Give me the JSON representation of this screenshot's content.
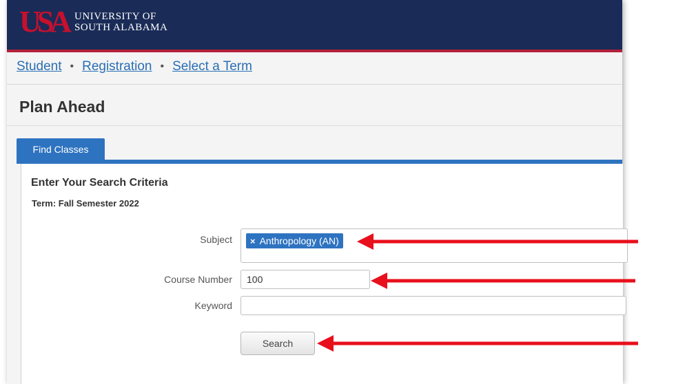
{
  "header": {
    "logo_mark": "USA",
    "logo_line1": "UNIVERSITY OF",
    "logo_line2": "SOUTH ALABAMA"
  },
  "breadcrumb": {
    "items": [
      "Student",
      "Registration",
      "Select a Term"
    ],
    "separator": "•"
  },
  "page": {
    "title": "Plan Ahead"
  },
  "tab": {
    "label": "Find Classes"
  },
  "criteria": {
    "heading": "Enter Your Search Criteria",
    "term": "Term: Fall Semester 2022"
  },
  "form": {
    "subject_label": "Subject",
    "subject_chip": "Anthropology (AN)",
    "subject_chip_remove": "×",
    "course_number_label": "Course Number",
    "course_number_value": "100",
    "keyword_label": "Keyword",
    "keyword_value": "",
    "search_label": "Search"
  },
  "colors": {
    "header_bg": "#1a2b57",
    "accent_red": "#c8102e",
    "tab_blue": "#2e73c0",
    "annotation_arrow": "#e8101c"
  }
}
